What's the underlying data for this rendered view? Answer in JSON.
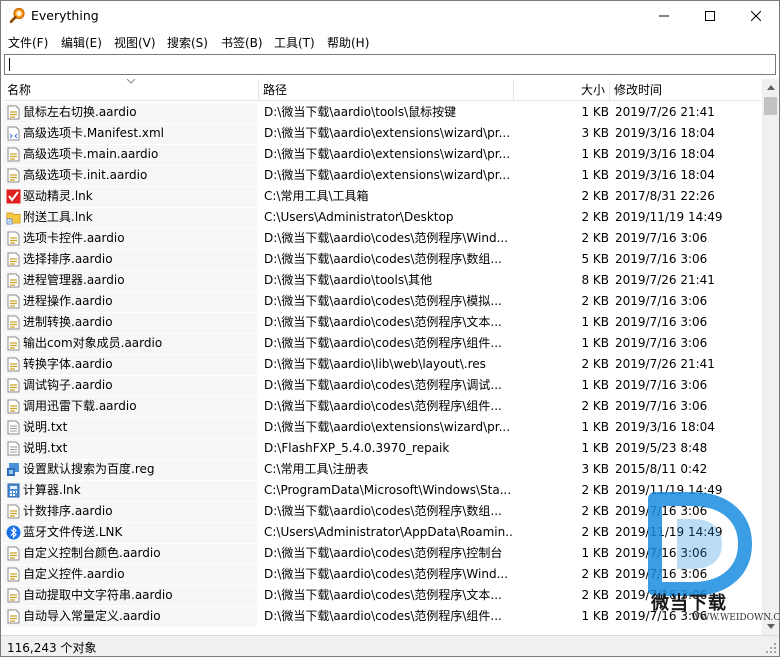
{
  "window": {
    "title": "Everything",
    "app_icon": "magnifier-icon",
    "controls": [
      "minimize-icon",
      "maximize-icon",
      "close-icon"
    ]
  },
  "menu": [
    "文件(F)",
    "编辑(E)",
    "视图(V)",
    "搜索(S)",
    "书签(B)",
    "工具(T)",
    "帮助(H)"
  ],
  "search": {
    "value": ""
  },
  "columns": {
    "name": "名称",
    "path": "路径",
    "size": "大小",
    "date": "修改时间"
  },
  "rows": [
    {
      "icon": "script-file-icon",
      "name": "鼠标左右切换.aardio",
      "path": "D:\\微当下载\\aardio\\tools\\鼠标按键",
      "size": "1 KB",
      "date": "2019/7/26 21:41"
    },
    {
      "icon": "xml-file-icon",
      "name": "高级选项卡.Manifest.xml",
      "path": "D:\\微当下载\\aardio\\extensions\\wizard\\pr...",
      "size": "3 KB",
      "date": "2019/3/16 18:04"
    },
    {
      "icon": "script-file-icon",
      "name": "高级选项卡.main.aardio",
      "path": "D:\\微当下载\\aardio\\extensions\\wizard\\pr...",
      "size": "1 KB",
      "date": "2019/3/16 18:04"
    },
    {
      "icon": "script-file-icon",
      "name": "高级选项卡.init.aardio",
      "path": "D:\\微当下载\\aardio\\extensions\\wizard\\pr...",
      "size": "1 KB",
      "date": "2019/3/16 18:04"
    },
    {
      "icon": "shortcut-red-icon",
      "name": "驱动精灵.lnk",
      "path": "C:\\常用工具\\工具箱",
      "size": "2 KB",
      "date": "2017/8/31 22:26"
    },
    {
      "icon": "folder-shortcut-icon",
      "name": "附送工具.lnk",
      "path": "C:\\Users\\Administrator\\Desktop",
      "size": "2 KB",
      "date": "2019/11/19 14:49"
    },
    {
      "icon": "script-file-icon",
      "name": "选项卡控件.aardio",
      "path": "D:\\微当下载\\aardio\\codes\\范例程序\\Wind...",
      "size": "2 KB",
      "date": "2019/7/16 3:06"
    },
    {
      "icon": "script-file-icon",
      "name": "选择排序.aardio",
      "path": "D:\\微当下载\\aardio\\codes\\范例程序\\数组...",
      "size": "5 KB",
      "date": "2019/7/16 3:06"
    },
    {
      "icon": "script-file-icon",
      "name": "进程管理器.aardio",
      "path": "D:\\微当下载\\aardio\\tools\\其他",
      "size": "8 KB",
      "date": "2019/7/26 21:41"
    },
    {
      "icon": "script-file-icon",
      "name": "进程操作.aardio",
      "path": "D:\\微当下载\\aardio\\codes\\范例程序\\模拟...",
      "size": "2 KB",
      "date": "2019/7/16 3:06"
    },
    {
      "icon": "script-file-icon",
      "name": "进制转换.aardio",
      "path": "D:\\微当下载\\aardio\\codes\\范例程序\\文本...",
      "size": "1 KB",
      "date": "2019/7/16 3:06"
    },
    {
      "icon": "script-file-icon",
      "name": "输出com对象成员.aardio",
      "path": "D:\\微当下载\\aardio\\codes\\范例程序\\组件...",
      "size": "1 KB",
      "date": "2019/7/16 3:06"
    },
    {
      "icon": "script-file-icon",
      "name": "转换字体.aardio",
      "path": "D:\\微当下载\\aardio\\lib\\web\\layout\\.res",
      "size": "2 KB",
      "date": "2019/7/26 21:41"
    },
    {
      "icon": "script-file-icon",
      "name": "调试钩子.aardio",
      "path": "D:\\微当下载\\aardio\\codes\\范例程序\\调试...",
      "size": "1 KB",
      "date": "2019/7/16 3:06"
    },
    {
      "icon": "script-file-icon",
      "name": "调用迅雷下载.aardio",
      "path": "D:\\微当下载\\aardio\\codes\\范例程序\\组件...",
      "size": "2 KB",
      "date": "2019/7/16 3:06"
    },
    {
      "icon": "text-file-icon",
      "name": "说明.txt",
      "path": "D:\\微当下载\\aardio\\extensions\\wizard\\pr...",
      "size": "1 KB",
      "date": "2019/3/16 18:04"
    },
    {
      "icon": "text-file-icon",
      "name": "说明.txt",
      "path": "D:\\FlashFXP_5.4.0.3970_repaik",
      "size": "1 KB",
      "date": "2019/5/23 8:48"
    },
    {
      "icon": "registry-file-icon",
      "name": "设置默认搜索为百度.reg",
      "path": "C:\\常用工具\\注册表",
      "size": "3 KB",
      "date": "2015/8/11 0:42"
    },
    {
      "icon": "calculator-shortcut-icon",
      "name": "计算器.lnk",
      "path": "C:\\ProgramData\\Microsoft\\Windows\\Sta...",
      "size": "2 KB",
      "date": "2019/11/19 14:49"
    },
    {
      "icon": "script-file-icon",
      "name": "计数排序.aardio",
      "path": "D:\\微当下载\\aardio\\codes\\范例程序\\数组...",
      "size": "2 KB",
      "date": "2019/7/16 3:06"
    },
    {
      "icon": "bluetooth-icon",
      "name": "蓝牙文件传送.LNK",
      "path": "C:\\Users\\Administrator\\AppData\\Roamin...",
      "size": "2 KB",
      "date": "2019/11/19 14:49"
    },
    {
      "icon": "script-file-icon",
      "name": "自定义控制台颜色.aardio",
      "path": "D:\\微当下载\\aardio\\codes\\范例程序\\控制台",
      "size": "1 KB",
      "date": "2019/7/16 3:06"
    },
    {
      "icon": "script-file-icon",
      "name": "自定义控件.aardio",
      "path": "D:\\微当下载\\aardio\\codes\\范例程序\\Wind...",
      "size": "2 KB",
      "date": "2019/7/16 3:06"
    },
    {
      "icon": "script-file-icon",
      "name": "自动提取中文字符串.aardio",
      "path": "D:\\微当下载\\aardio\\codes\\范例程序\\文本...",
      "size": "2 KB",
      "date": "2019/7/16 3:06"
    },
    {
      "icon": "script-file-icon",
      "name": "自动导入常量定义.aardio",
      "path": "D:\\微当下载\\aardio\\codes\\范例程序\\组件...",
      "size": "1 KB",
      "date": "2019/7/16 3:06"
    }
  ],
  "status": {
    "count": "116,243 个对象"
  },
  "watermark": {
    "brand": "微当下载",
    "url": "WWW.WEIDOWN.COM"
  },
  "colors": {
    "row_name_bg": "#f7f7f7",
    "script_icon": "#c9a227",
    "folder": "#f5c842",
    "shortcut_red": "#e02020",
    "bluetooth": "#1b73e8"
  }
}
